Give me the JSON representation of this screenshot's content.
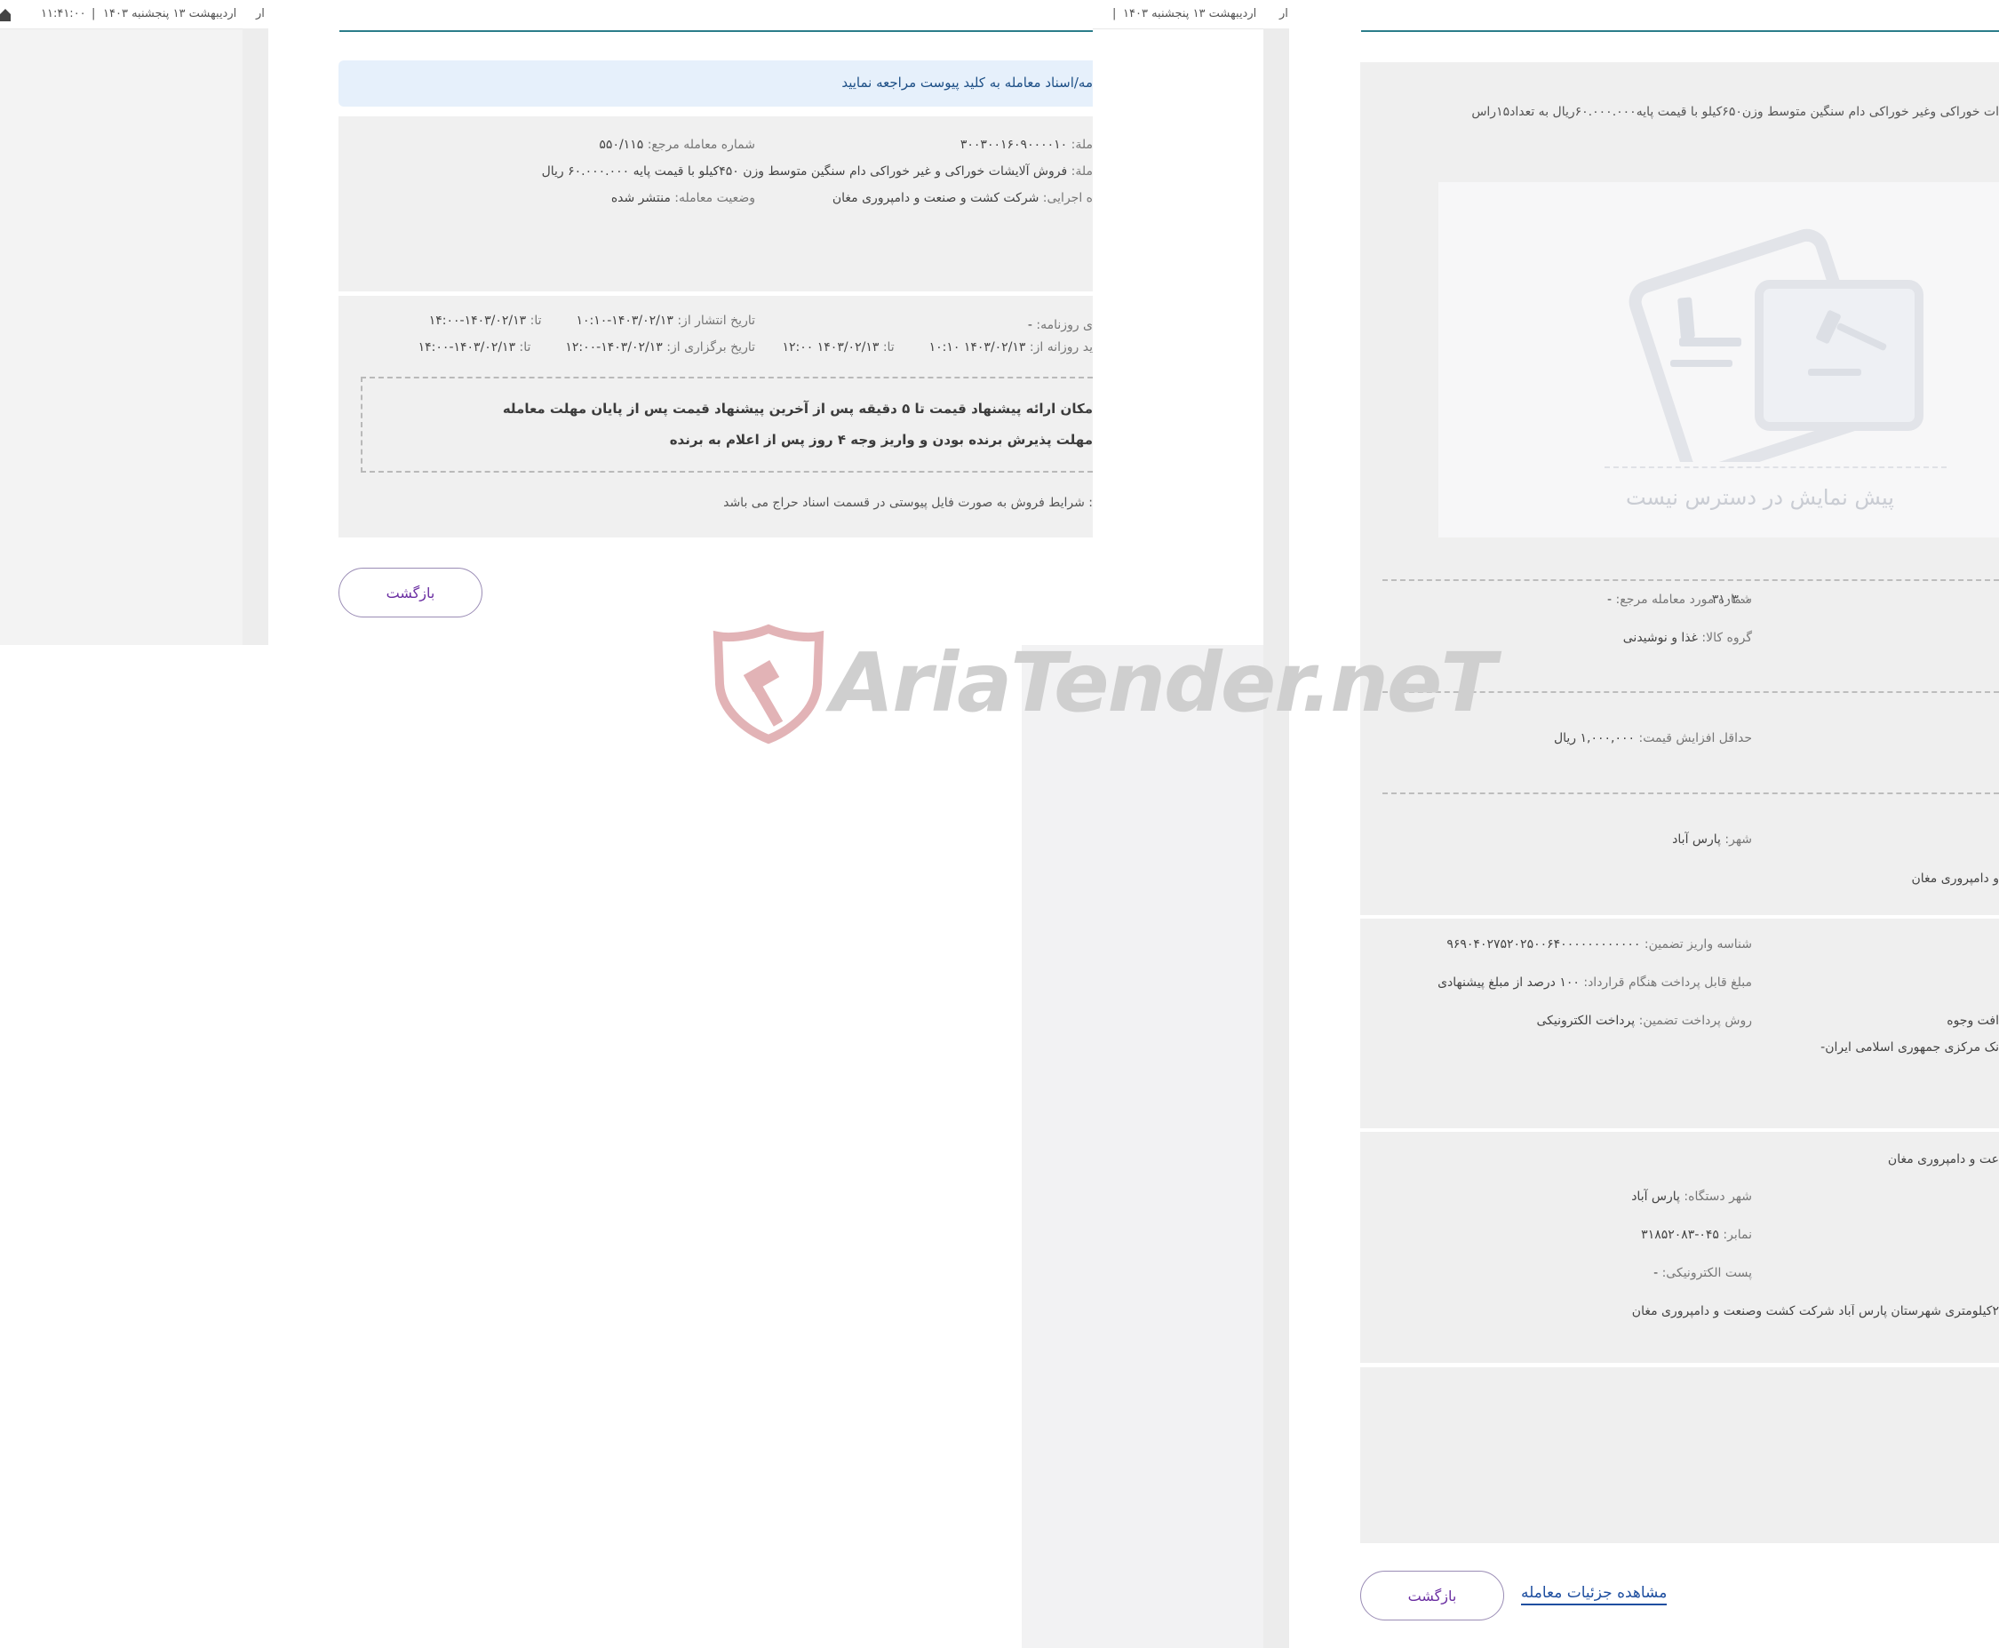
{
  "bg_window": {
    "topbar_date": "اردیبهشت ۱۳ پنجشنبه ۱۴۰۳",
    "topbar_separator": "|",
    "topbar_time": "۱۱:۴۱:۰۰",
    "topbar_fragment": "ار"
  },
  "middle_window": {
    "topbar_date": "اردیبهشت ۱۳ پنجشنبه ۱۴۰۳",
    "topbar_separator": "|",
    "topbar_fragment_left": "۱۴",
    "topbar_fragment_right": "ار",
    "alert_text": "مه/اسناد معامله به کلید پیوست مراجعه نمایید",
    "deal_label": "ملة:",
    "deal_value": "۳۰۰۳۰۰۱۶۰۹۰۰۰۰۱۰",
    "ref_label": "شماره معامله مرجع:",
    "ref_value": "۵۵۰/۱۱۵",
    "title_label": "ملة:",
    "title_value": "فروش آلایشات خوراکی و غیر خوراکی دام سنگین متوسط وزن ۴۵۰کیلو با قیمت پایه ۶۰.۰۰۰.۰۰۰ ریال",
    "exec_label": "ه اجرایی:",
    "exec_value": "شرکت کشت و صنعت و دامپروری مغان",
    "status_label": "وضعیت معامله:",
    "status_value": "منتشر شده",
    "newspaper_label": "ی روزنامه:",
    "newspaper_value": "-",
    "publish_label": "تاریخ انتشار از:",
    "publish_from": "۱۴۰۳/۰۲/۱۳-۱۰:۱۰",
    "to_label": "تا:",
    "publish_to": "۱۴۰۳/۰۲/۱۳-۱۴:۰۰",
    "daily_label": "ید روزانه از:",
    "daily_from": "۱۴۰۳/۰۲/۱۳ ۱۰:۱۰",
    "daily_to": "۱۴۰۳/۰۲/۱۳ ۱۲:۰۰",
    "hold_label": "تاریخ برگزاری از:",
    "hold_from": "۱۴۰۳/۰۲/۱۳-۱۲:۰۰",
    "hold_to": "۱۴۰۳/۰۲/۱۳-۱۴:۰۰",
    "note_line1": "مکان ارائه پیشنهاد قیمت تا ۵ دقیقه پس از آخرین پیشنهاد قیمت پس از پایان مهلت معامله",
    "note_line2": "مهلت پذیرش برنده بودن و واریز وجه ۴ روز پس از اعلام به برنده",
    "terms_text": ": شرایط فروش به صورت فایل پیوستی در قسمت اسناد حراج می باشد",
    "back_button": "بازگشت"
  },
  "right_window": {
    "intro_text": "ات خوراکی وغیر خوراکی دام سنگین متوسط وزن۶۵۰کیلو با قیمت پایه۶۰.۰۰۰.۰۰۰ریال به تعداد۱۵راس",
    "preview_unavailable": "پیش نمایش در دسترس نیست",
    "deal_number_fragment": "۳۱۰۳۰۰",
    "ref_item_label": "شماره مورد معامله مرجع:",
    "ref_item_value": "-",
    "goods_group_label": "گروه کالا:",
    "goods_group_value": "غذا و نوشیدنی",
    "min_increase_label": "حداقل افزایش قیمت:",
    "min_increase_value": "۱,۰۰۰,۰۰۰ ریال",
    "city_label": "شهر:",
    "city_value": "پارس آباد",
    "org_fragment": "و دامپروری مغان",
    "guarantee_id_label": "شناسه واریز تضمین:",
    "guarantee_id_value": "۹۶۹۰۴۰۲۷۵۲۰۲۵۰۰۶۴۰۰۰۰۰۰۰۰۰۰۰۰",
    "contract_amount_label": "مبلغ قابل پرداخت هنگام قرارداد:",
    "contract_amount_value": "۱۰۰ درصد از مبلغ پیشنهادی",
    "guarantee_method_label": "روش پرداخت تضمین:",
    "guarantee_method_value": "پرداخت الکترونیکی",
    "receive_fragment": "افت وجوه",
    "bank_fragment": "نک مرکزی جمهوری اسلامی ایران-",
    "org_full_fragment": "عت و دامپروری مغان",
    "device_city_label": "شهر دستگاه:",
    "device_city_value": "پارس آباد",
    "fax_label": "نمابر:",
    "fax_value": "۰۴۵-۳۱۸۵۲۰۸۳",
    "email_label": "پست الکترونیکی:",
    "email_value": "-",
    "address_fragment": "۲کیلومتری شهرستان پارس آباد شرکت کشت وصنعت و دامپروری مغان",
    "back_button": "بازگشت",
    "details_link": "مشاهده جزئیات معامله"
  },
  "watermark": {
    "text": "AriaTender.neT"
  },
  "colors": {
    "accent_teal": "#2b7d8a",
    "link_blue": "#1f4fa0",
    "button_purple": "#6b2fa2",
    "panel_gray": "#f0f0f0",
    "alert_bg": "#e6f0fb",
    "watermark_red": "#d9a0a4",
    "watermark_gray": "#c9c9c9"
  }
}
